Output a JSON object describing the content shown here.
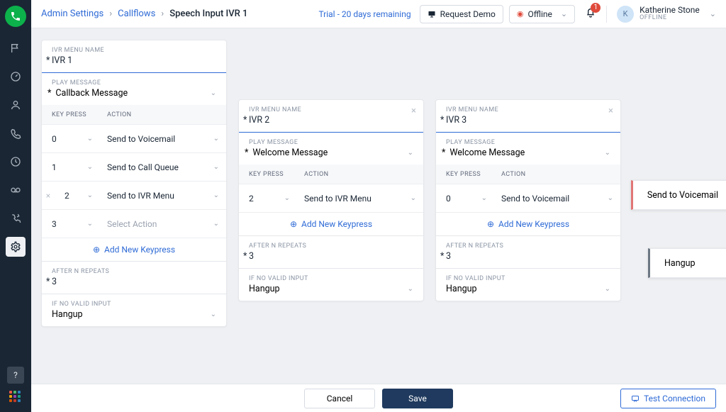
{
  "breadcrumb": {
    "root": "Admin Settings",
    "mid": "Callflows",
    "current": "Speech Input IVR 1"
  },
  "topbar": {
    "trial": "Trial - 20 days remaining",
    "request_demo": "Request Demo",
    "offline": "Offline",
    "bell_count": "1",
    "user_name": "Katherine Stone",
    "user_status": "OFFLINE",
    "user_initial": "K"
  },
  "labels": {
    "ivr_menu_name": "IVR MENU NAME",
    "play_message": "PLAY MESSAGE",
    "key_press": "KEY PRESS",
    "action": "ACTION",
    "add_keypress": "Add New Keypress",
    "after_n_repeats": "AFTER N REPEATS",
    "if_no_valid_input": "IF NO VALID INPUT",
    "select_action": "Select Action"
  },
  "ivr1": {
    "name": "IVR 1",
    "play_message": "Callback Message",
    "rows": [
      {
        "key": "0",
        "action": "Send to Voicemail"
      },
      {
        "key": "1",
        "action": "Send to Call Queue"
      },
      {
        "key": "2",
        "action": "Send to IVR Menu"
      },
      {
        "key": "3",
        "action": ""
      }
    ],
    "repeats": "3",
    "no_valid": "Hangup"
  },
  "ivr2": {
    "name": "IVR 2",
    "play_message": "Welcome Message",
    "rows": [
      {
        "key": "2",
        "action": "Send to IVR Menu"
      }
    ],
    "repeats": "3",
    "no_valid": "Hangup"
  },
  "ivr3": {
    "name": "IVR 3",
    "play_message": "Welcome Message",
    "rows": [
      {
        "key": "0",
        "action": "Send to Voicemail"
      }
    ],
    "repeats": "3",
    "no_valid": "Hangup"
  },
  "floaters": {
    "top": "Send to Voicemail",
    "bottom": "Hangup"
  },
  "footer": {
    "cancel": "Cancel",
    "save": "Save",
    "test": "Test Connection"
  }
}
